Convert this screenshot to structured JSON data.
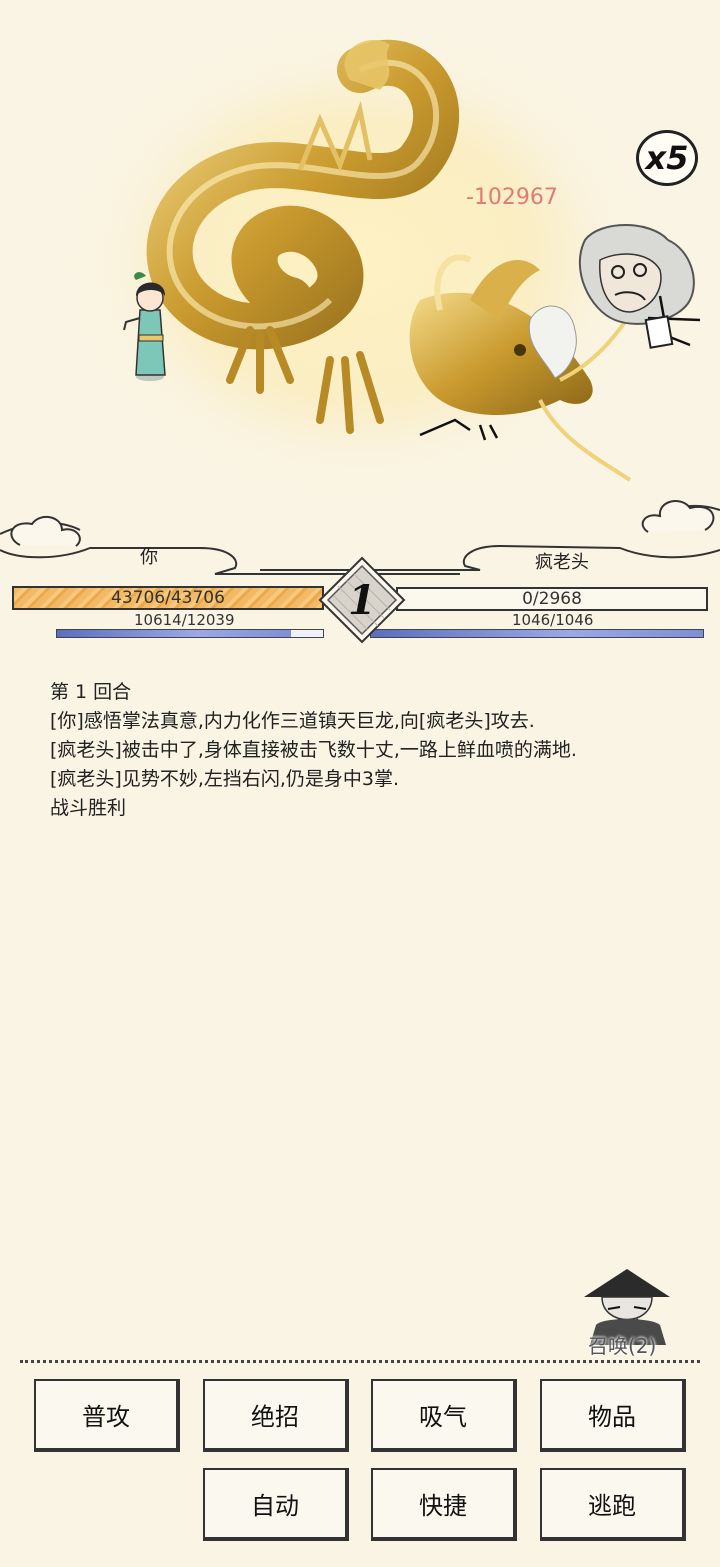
{
  "battle": {
    "speed_multiplier": "x5",
    "damage_popup": "-102967",
    "round_number": "1"
  },
  "player": {
    "name": "你",
    "hp_text": "43706/43706",
    "hp_fraction": 1.0,
    "mp_text": "10614/12039",
    "mp_fraction": 0.88
  },
  "enemy": {
    "name": "疯老头",
    "hp_text": "0/2968",
    "hp_fraction": 0.0,
    "mp_text": "1046/1046",
    "mp_fraction": 1.0
  },
  "log": [
    "第 1 回合",
    "[你]感悟掌法真意,内力化作三道镇天巨龙,向[疯老头]攻去.",
    "[疯老头]被击中了,身体直接被击飞数十丈,一路上鲜血喷的满地.",
    "[疯老头]见势不妙,左挡右闪,仍是身中3掌.",
    "战斗胜利"
  ],
  "summon": {
    "label": "召唤(2)"
  },
  "actions": {
    "attack": "普攻",
    "ultimate": "绝招",
    "breathe": "吸气",
    "items": "物品",
    "auto": "自动",
    "shortcut": "快捷",
    "flee": "逃跑"
  }
}
